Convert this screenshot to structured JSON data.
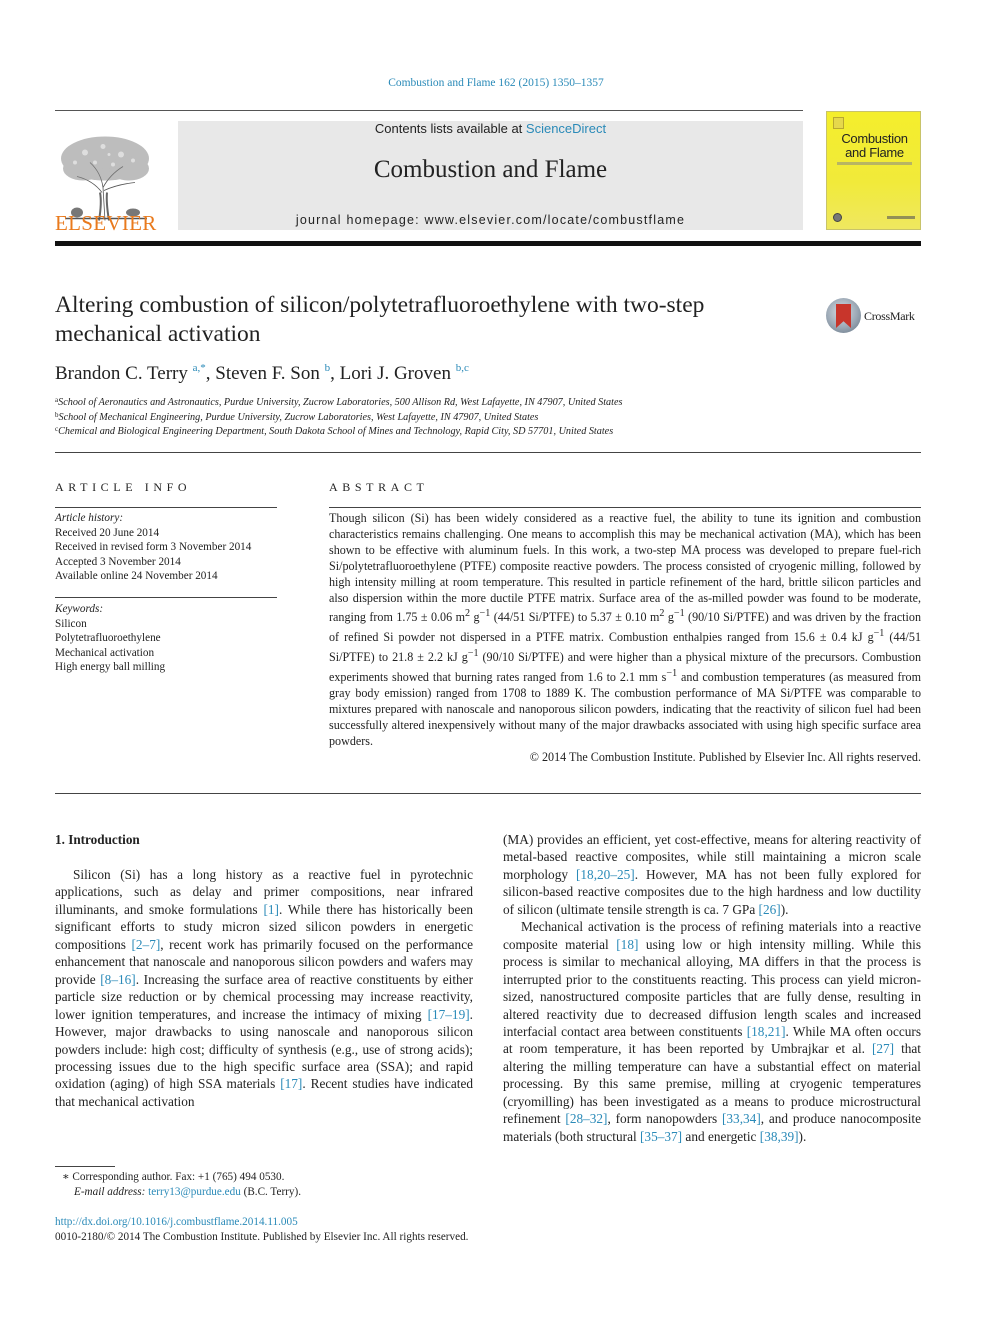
{
  "running_head": "Combustion and Flame 162 (2015) 1350–1357",
  "masthead": {
    "publisher": "ELSEVIER",
    "contents_prefix": "Contents lists available at ",
    "contents_link": "ScienceDirect",
    "journal_title": "Combustion and Flame",
    "homepage": "journal homepage: www.elsevier.com/locate/combustflame",
    "cover_title_line1": "Combustion",
    "cover_title_line2": "and Flame"
  },
  "article": {
    "title": "Altering combustion of silicon/polytetrafluoroethylene with two-step mechanical activation",
    "crossmark_label": "CrossMark",
    "authors": [
      {
        "name": "Brandon C. Terry",
        "sup": "a,*"
      },
      {
        "name": "Steven F. Son",
        "sup": "b"
      },
      {
        "name": "Lori J. Groven",
        "sup": "b,c"
      }
    ],
    "affiliations": [
      {
        "key": "a",
        "text": "School of Aeronautics and Astronautics, Purdue University, Zucrow Laboratories, 500 Allison Rd, West Lafayette, IN 47907, United States"
      },
      {
        "key": "b",
        "text": "School of Mechanical Engineering, Purdue University, Zucrow Laboratories, West Lafayette, IN 47907, United States"
      },
      {
        "key": "c",
        "text": "Chemical and Biological Engineering Department, South Dakota School of Mines and Technology, Rapid City, SD 57701, United States"
      }
    ]
  },
  "article_info": {
    "heading": "ARTICLE INFO",
    "history_label": "Article history:",
    "history": [
      "Received 20 June 2014",
      "Received in revised form 3 November 2014",
      "Accepted 3 November 2014",
      "Available online 24 November 2014"
    ],
    "keywords_label": "Keywords:",
    "keywords": [
      "Silicon",
      "Polytetrafluoroethylene",
      "Mechanical activation",
      "High energy ball milling"
    ]
  },
  "abstract": {
    "heading": "ABSTRACT",
    "parts": {
      "p1": "Though silicon (Si) has been widely considered as a reactive fuel, the ability to tune its ignition and com­bustion characteristics remains challenging. One means to accomplish this may be mechanical activation (MA), which has been shown to be effective with aluminum fuels. In this work, a two-step MA process was developed to prepare fuel-rich Si/polytetrafluoroethylene (PTFE) composite reactive powders. The process consisted of cryogenic milling, followed by high intensity milling at room temperature. This resulted in particle refinement of the hard, brittle silicon particles and also dispersion within the more ductile PTFE matrix. Surface area of the as-milled powder was found to be moderate, ranging from 1.75 ± 0.06 m",
      "sup2a": "2",
      "p2": " g",
      "supm1a": "−1",
      "p3": " (44/51 Si/PTFE) to 5.37 ± 0.10 m",
      "sup2b": "2",
      "p4": " g",
      "supm1b": "−1",
      "p5": " (90/10 Si/PTFE) and was driven by the fraction of refined Si powder not dispersed in a PTFE matrix. Combustion enthalpies ranged from 15.6 ± 0.4 kJ g",
      "supm1c": "−1",
      "p6": " (44/51 Si/PTFE) to 21.8 ± 2.2 kJ g",
      "supm1d": "−1",
      "p7": " (90/10 Si/PTFE) and were higher than a physical mixture of the pre­cursors. Combustion experiments showed that burning rates ranged from 1.6 to 2.1 mm s",
      "supm1e": "−1",
      "p8": " and combus­tion temperatures (as measured from gray body emission) ranged from 1708 to 1889 K. The combustion performance of MA Si/PTFE was comparable to mixtures prepared with nanoscale and nanoporous silicon powders, indicating that the reactivity of silicon fuel had been successfully altered inexpensively without many of the major drawbacks associated with using high specific surface area powders."
    },
    "copyright": "© 2014 The Combustion Institute. Published by Elsevier Inc. All rights reserved."
  },
  "introduction": {
    "heading": "1. Introduction",
    "left": {
      "t1": "Silicon (Si) has a long history as a reactive fuel in pyrotechnic applications, such as delay and primer compositions, near infrared illuminants, and smoke formulations ",
      "r1": "[1]",
      "t2": ". While there has histori­cally been significant efforts to study micron sized silicon powders in energetic compositions ",
      "r2": "[2–7]",
      "t3": ", recent work has primarily focused on the performance enhancement that nanoscale and nanoporous silicon powders and wafers may provide ",
      "r3": "[8–16]",
      "t4": ". Increasing the surface area of reactive constituents by either particle size reduc­tion or by chemical processing may increase reactivity, lower igni­tion temperatures, and increase the intimacy of mixing ",
      "r4": "[17–19]",
      "t5": ". However, major drawbacks to using nanoscale and nanoporous sil­icon powders include: high cost; difficulty of synthesis (e.g., use of strong acids); processing issues due to the high specific surface area (SSA); and rapid oxidation (aging) of high SSA materials ",
      "r5": "[17]",
      "t6": ". Recent studies have indicated that mechanical activation"
    },
    "right": {
      "a1": "(MA) provides an efficient, yet cost-effective, means for altering reactivity of metal-based reactive composites, while still maintain­ing a micron scale morphology ",
      "ar1": "[18,20–25]",
      "a2": ". However, MA has not been fully explored for silicon-based reactive composites due to the high hardness and low ductility of silicon (ultimate tensile strength is ca. 7 GPa ",
      "ar2": "[26]",
      "a3": ").",
      "b1": "Mechanical activation is the process of refining materials into a reactive composite material ",
      "br1": "[18]",
      "b2": " using low or high intensity mill­ing. While this process is similar to mechanical alloying, MA differs in that the process is interrupted prior to the constituents reacting. This process can yield micron-sized, nanostructured composite particles that are fully dense, resulting in altered reactivity due to decreased diffusion length scales and increased interfacial con­tact area between constituents ",
      "br2": "[18,21]",
      "b3": ". While MA often occurs at room temperature, it has been reported by Umbrajkar et al. ",
      "br3": "[27]",
      "b4": " that altering the milling temperature can have a substantial effect on material processing. By this same premise, milling at cryogenic temperatures (cryomilling) has been investigated as a means to produce microstructural refinement ",
      "br4": "[28–32]",
      "b5": ", form nanopowders ",
      "br5": "[33,34]",
      "b6": ", and produce nanocomposite materials (both structural ",
      "br6": "[35–37]",
      "b7": " and energetic ",
      "br7": "[38,39]",
      "b8": ")."
    }
  },
  "footnotes": {
    "corresponding": "∗  Corresponding author. Fax: +1 (765) 494 0530.",
    "email_label": "E-mail address:",
    "email": "terry13@purdue.edu",
    "email_suffix": " (B.C. Terry)."
  },
  "doi": "http://dx.doi.org/10.1016/j.combustflame.2014.11.005",
  "issn_line": "0010-2180/© 2014 The Combustion Institute. Published by Elsevier Inc. All rights reserved.",
  "colors": {
    "link": "#2a8ab8",
    "elsevier_orange": "#e97a1d",
    "cover_yellow": "#f4ee2c",
    "masthead_gray": "#e8e8e8"
  }
}
